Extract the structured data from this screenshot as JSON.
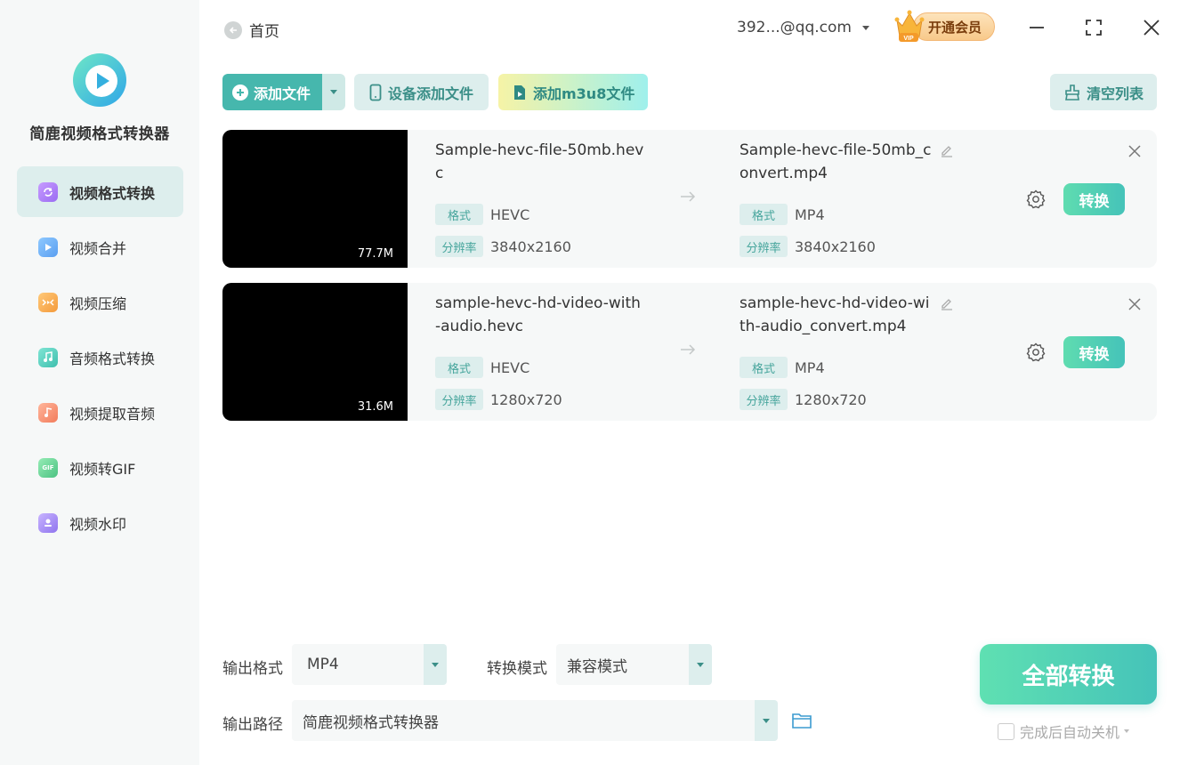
{
  "sidebar": {
    "app_name": "简鹿视频格式转换器",
    "items": [
      {
        "label": "视频格式转换",
        "icon": "video-convert-icon",
        "color": "#b27cf7",
        "active": true
      },
      {
        "label": "视频合并",
        "icon": "video-merge-icon",
        "color": "#6aaef5"
      },
      {
        "label": "视频压缩",
        "icon": "video-compress-icon",
        "color": "#f6a84e"
      },
      {
        "label": "音频格式转换",
        "icon": "audio-convert-icon",
        "color": "#55d2c0"
      },
      {
        "label": "视频提取音频",
        "icon": "extract-audio-icon",
        "color": "#f79a7a"
      },
      {
        "label": "视频转GIF",
        "icon": "gif-icon",
        "color": "#6fd49b"
      },
      {
        "label": "视频水印",
        "icon": "watermark-icon",
        "color": "#a58af5"
      }
    ]
  },
  "header": {
    "home_label": "首页",
    "account": "392...@qq.com",
    "vip_label": "开通会员",
    "vip_badge": "VIP"
  },
  "toolbar": {
    "add_file": "添加文件",
    "device_add": "设备添加文件",
    "add_m3u8": "添加m3u8文件",
    "clear_list": "清空列表"
  },
  "files": [
    {
      "size": "77.7M",
      "source_name": "Sample-hevc-file-50mb.hevc",
      "source_format": "HEVC",
      "source_resolution": "3840x2160",
      "output_name": "Sample-hevc-file-50mb_convert.mp4",
      "output_format": "MP4",
      "output_resolution": "3840x2160",
      "format_tag": "格式",
      "resolution_tag": "分辨率",
      "convert_label": "转换"
    },
    {
      "size": "31.6M",
      "source_name": "sample-hevc-hd-video-with-audio.hevc",
      "source_format": "HEVC",
      "source_resolution": "1280x720",
      "output_name": "sample-hevc-hd-video-with-audio_convert.mp4",
      "output_format": "MP4",
      "output_resolution": "1280x720",
      "format_tag": "格式",
      "resolution_tag": "分辨率",
      "convert_label": "转换"
    }
  ],
  "bottom": {
    "output_format_label": "输出格式",
    "output_format_value": "MP4",
    "convert_mode_label": "转换模式",
    "convert_mode_value": "兼容模式",
    "output_path_label": "输出路径",
    "output_path_value": "简鹿视频格式转换器",
    "convert_all": "全部转换",
    "shutdown_label": "完成后自动关机"
  },
  "colors": {
    "accent": "#46b7ad",
    "accent_light": "#ddeeed",
    "sidebar_bg": "#f6f8f8"
  }
}
